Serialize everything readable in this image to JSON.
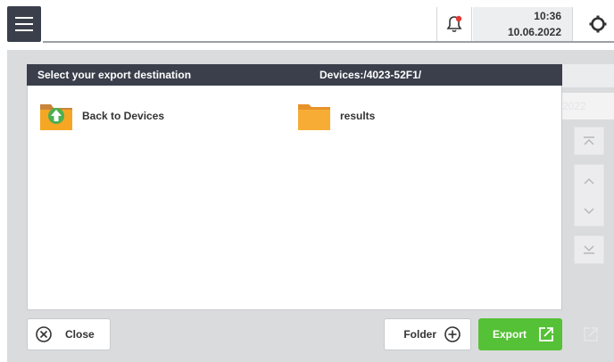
{
  "topbar": {
    "menu_icon": "hamburger-icon",
    "bell_icon": "bell-icon",
    "notification_color": "#e53935",
    "time": "10:36",
    "date": "10.06.2022",
    "settings_icon": "gear-icon"
  },
  "background": {
    "date_partial": "2022",
    "scroll_icons": [
      "scroll-top-icon",
      "scroll-up-icon",
      "scroll-down-icon",
      "scroll-bottom-icon"
    ]
  },
  "dialog": {
    "title": "Select your export destination",
    "path": "Devices:/4023-52F1/",
    "items": [
      {
        "label": "Back to Devices",
        "icon": "folder-up-icon"
      },
      {
        "label": "results",
        "icon": "folder-icon"
      }
    ]
  },
  "buttons": {
    "close_label": "Close",
    "folder_label": "Folder",
    "export_label": "Export"
  },
  "colors": {
    "header_dark": "#3a3f4b",
    "export_green": "#55c136",
    "folder_orange": "#f5a623",
    "folder_up_green": "#4caf50"
  }
}
